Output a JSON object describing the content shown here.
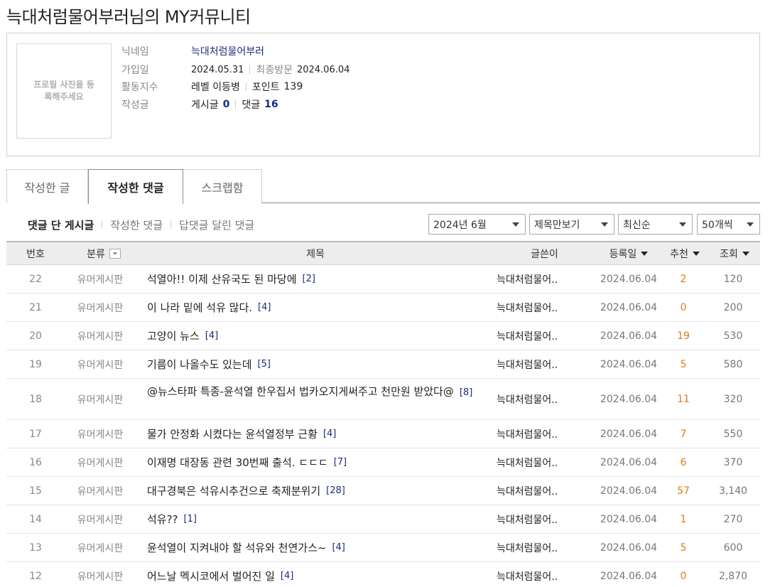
{
  "page_title": "늑대처럼물어부러님의 MY커뮤니티",
  "profile": {
    "photo_placeholder": "프로필 사진을 등록해주세요",
    "nickname_label": "닉네임",
    "nickname": "늑대처럼물어부러",
    "join_label": "가입일",
    "join_date": "2024.05.31",
    "last_visit_label": "최종방문",
    "last_visit": "2024.06.04",
    "activity_label": "활동지수",
    "level": "레벨 이등병",
    "points_label": "포인트",
    "points": "139",
    "written_label": "작성글",
    "posts_label": "게시글",
    "posts_count": "0",
    "comments_label": "댓글",
    "comments_count": "16"
  },
  "tabs": [
    {
      "label": "작성한 글"
    },
    {
      "label": "작성한 댓글"
    },
    {
      "label": "스크랩함"
    }
  ],
  "subnav": [
    {
      "label": "댓글 단 게시글"
    },
    {
      "label": "작성한 댓글"
    },
    {
      "label": "답댓글 달린 댓글"
    }
  ],
  "filters": {
    "month": "2024년 6월",
    "view_mode": "제목만보기",
    "sort": "최신순",
    "per_page": "50개씩"
  },
  "columns": {
    "num": "번호",
    "category": "분류",
    "title": "제목",
    "author": "글쓴이",
    "date": "등록일",
    "recommend": "추천",
    "views": "조회"
  },
  "rows": [
    {
      "num": "22",
      "category": "유머게시판",
      "title": "석열아!! 이제 산유국도 된 마당에",
      "comments": "[2]",
      "author": "늑대처럼물어..",
      "date": "2024.06.04",
      "recommend": "2",
      "views": "120"
    },
    {
      "num": "21",
      "category": "유머게시판",
      "title": "이 나라 밑에 석유 많다.",
      "comments": "[4]",
      "author": "늑대처럼물어..",
      "date": "2024.06.04",
      "recommend": "0",
      "views": "200"
    },
    {
      "num": "20",
      "category": "유머게시판",
      "title": "고양이 뉴스",
      "comments": "[4]",
      "author": "늑대처럼물어..",
      "date": "2024.06.04",
      "recommend": "19",
      "views": "530"
    },
    {
      "num": "19",
      "category": "유머게시판",
      "title": "기름이 나올수도 있는데",
      "comments": "[5]",
      "author": "늑대처럼물어..",
      "date": "2024.06.04",
      "recommend": "5",
      "views": "580"
    },
    {
      "num": "18",
      "category": "유머게시판",
      "title": "@뉴스타파 특종-윤석열 한우집서 법카오지게써주고 천만원 받았다@",
      "comments": "[8]",
      "author": "늑대처럼물어..",
      "date": "2024.06.04",
      "recommend": "11",
      "views": "320"
    },
    {
      "num": "17",
      "category": "유머게시판",
      "title": "물가 안정화 시켰다는 윤석열정부 근황",
      "comments": "[4]",
      "author": "늑대처럼물어..",
      "date": "2024.06.04",
      "recommend": "7",
      "views": "550"
    },
    {
      "num": "16",
      "category": "유머게시판",
      "title": "이재명 대장동 관련 30번째 출석. ㄷㄷㄷ",
      "comments": "[7]",
      "author": "늑대처럼물어..",
      "date": "2024.06.04",
      "recommend": "6",
      "views": "370"
    },
    {
      "num": "15",
      "category": "유머게시판",
      "title": "대구경북은 석유시추건으로 축제분위기",
      "comments": "[28]",
      "author": "늑대처럼물어..",
      "date": "2024.06.04",
      "recommend": "57",
      "views": "3,140"
    },
    {
      "num": "14",
      "category": "유머게시판",
      "title": "석유??",
      "comments": "[1]",
      "author": "늑대처럼물어..",
      "date": "2024.06.04",
      "recommend": "1",
      "views": "270"
    },
    {
      "num": "13",
      "category": "유머게시판",
      "title": "윤석열이 지켜내야 할 석유와 천연가스~",
      "comments": "[4]",
      "author": "늑대처럼물어..",
      "date": "2024.06.04",
      "recommend": "5",
      "views": "600"
    },
    {
      "num": "12",
      "category": "유머게시판",
      "title": "어느날 멕시코에서 벌어진 일",
      "comments": "[4]",
      "author": "늑대처럼물어..",
      "date": "2024.06.04",
      "recommend": "0",
      "views": "2,870"
    }
  ]
}
